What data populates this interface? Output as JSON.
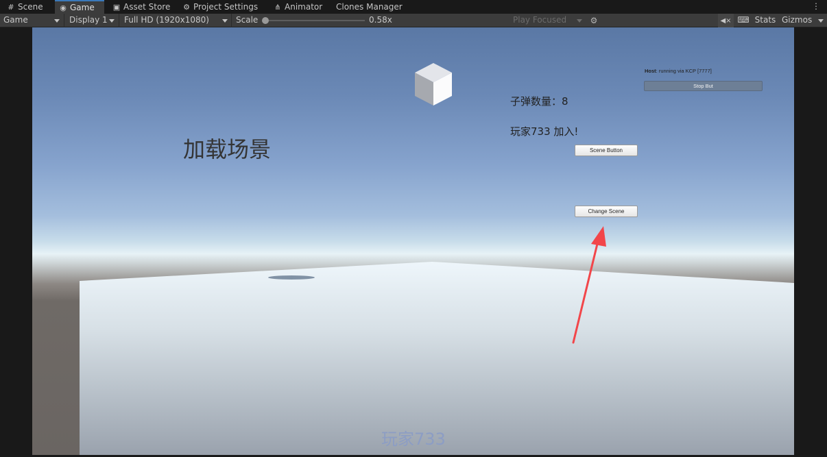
{
  "tabs": [
    {
      "label": "Scene",
      "icon": "grid-icon",
      "active": false
    },
    {
      "label": "Game",
      "icon": "gamepad-icon",
      "active": true
    },
    {
      "label": "Asset Store",
      "icon": "store-icon",
      "active": false
    },
    {
      "label": "Project Settings",
      "icon": "gear-icon",
      "active": false
    },
    {
      "label": "Animator",
      "icon": "animator-icon",
      "active": false
    },
    {
      "label": "Clones Manager",
      "icon": "",
      "active": false
    }
  ],
  "toolbar": {
    "view_mode": "Game",
    "display": "Display 1",
    "resolution": "Full HD (1920x1080)",
    "scale_label": "Scale",
    "scale_value": "0.58x",
    "scale_fraction": 0.0,
    "play_mode": "Play Focused",
    "stats_label": "Stats",
    "gizmos_label": "Gizmos"
  },
  "game": {
    "title_text": "加载场景",
    "bullet_count_text": "子弹数量：8",
    "join_text": "玩家733 加入!",
    "scene_button_label": "Scene Button",
    "change_scene_label": "Change Scene",
    "host_prefix": "Host",
    "host_status": ": running via KCP [7777]",
    "stop_button_label": "Stop But",
    "player_name": "玩家733"
  },
  "colors": {
    "accent_tab": "#3a79bb",
    "annotation_arrow": "#f2464a",
    "stop_button": "#6d7f96"
  }
}
